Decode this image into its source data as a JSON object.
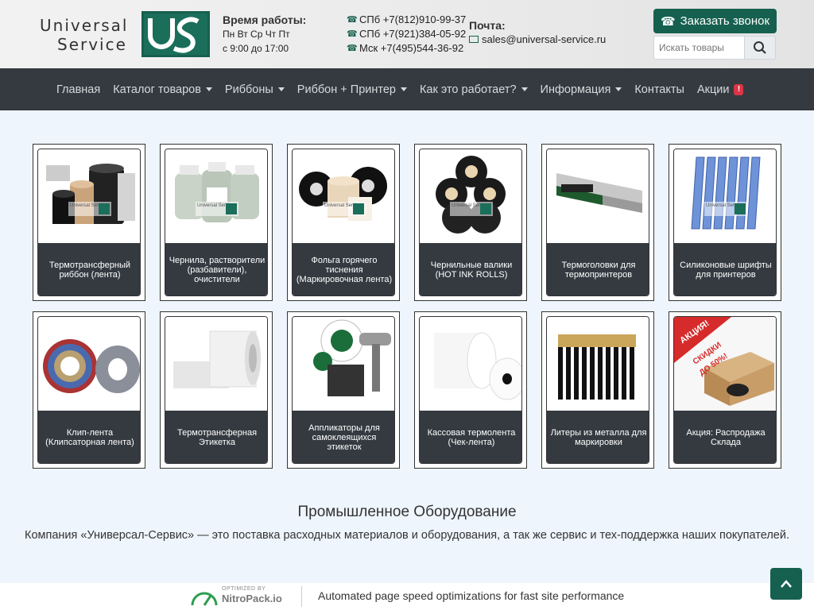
{
  "header": {
    "logo": {
      "line1": "Universal",
      "line2": "Service"
    },
    "hours": {
      "title": "Время работы:",
      "days": "Пн Вт Ср Чт Пт",
      "time": "с 9:00 до 17:00"
    },
    "phones": [
      "СПб +7(812)910-99-37",
      "СПб +7(921)384-05-92",
      "Мск +7(495)544-36-92"
    ],
    "mail": {
      "title": "Почта:",
      "address": "sales@universal-service.ru"
    },
    "call_button": "Заказать звонок",
    "search": {
      "placeholder": "Искать товары"
    }
  },
  "nav": {
    "items": [
      {
        "label": "Главная",
        "dropdown": false
      },
      {
        "label": "Каталог товаров",
        "dropdown": true
      },
      {
        "label": "Риббоны",
        "dropdown": true
      },
      {
        "label": "Риббон + Принтер",
        "dropdown": true
      },
      {
        "label": "Как это работает?",
        "dropdown": true
      },
      {
        "label": "Информация",
        "dropdown": true
      },
      {
        "label": "Контакты",
        "dropdown": false
      },
      {
        "label": "Акции",
        "dropdown": false,
        "badge": "!"
      }
    ]
  },
  "catalog": {
    "watermark": "Universal Service",
    "cards": [
      {
        "title": "Термотрансферный риббон (лента)"
      },
      {
        "title": "Чернила, растворители (разбавители), очистители"
      },
      {
        "title": "Фольга горячего тиснения (Маркировочная лента)"
      },
      {
        "title": "Чернильные валики (HOT INK ROLLS)"
      },
      {
        "title": "Термоголовки для термопринтеров"
      },
      {
        "title": "Силиконовые шрифты для принтеров"
      },
      {
        "title": "Клип-лента (Клипсаторная лента)"
      },
      {
        "title": "Термотрансферная Этикетка"
      },
      {
        "title": "Аппликаторы для самоклеящихся этикеток"
      },
      {
        "title": "Кассовая термолента (Чек-лента)"
      },
      {
        "title": "Литеры из металла для маркировки"
      },
      {
        "title": "Акция: Распродажа Склада",
        "promo": {
          "line1": "АКЦИЯ!",
          "line2": "СКИДКИ",
          "line3": "ДО 50%!"
        }
      }
    ]
  },
  "section": {
    "heading": "Промышленное Оборудование",
    "description": "Компания «Универсал-Сервис» — это поставка расходных материалов и оборудования, а так же сервис и тех-поддержка наших покупателей."
  },
  "footer": {
    "optimized_by": "OPTIMIZED BY",
    "brand": "NitroPack.io",
    "text": "Automated page speed optimizations for fast site performance"
  },
  "colors": {
    "brand_green": "#16604f",
    "nav_bg": "#343a40",
    "page_bg": "#eef5fd",
    "badge_red": "#dc3545"
  }
}
